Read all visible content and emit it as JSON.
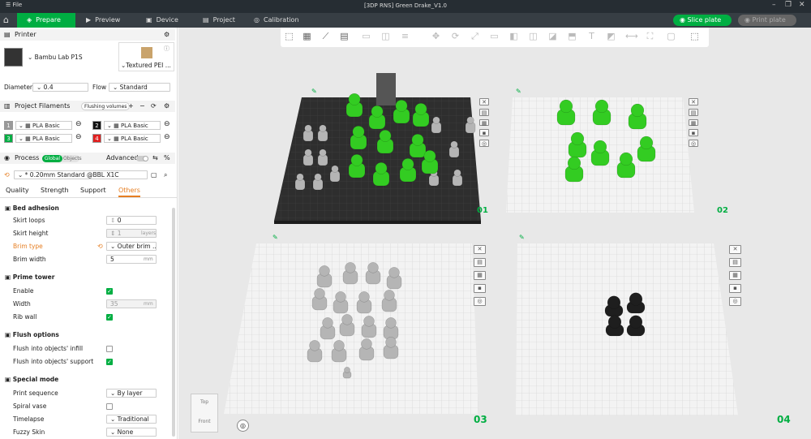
{
  "titlebar": {
    "file": "File",
    "title": "[3DP RNS] Green Drake_V1.0"
  },
  "nav": {
    "prepare": "Prepare",
    "preview": "Preview",
    "device": "Device",
    "project": "Project",
    "calibration": "Calibration",
    "slice": "Slice plate",
    "print": "Print plate"
  },
  "printer": {
    "section": "Printer",
    "name": "Bambu Lab P1S",
    "plate": "Textured PEI ...",
    "diameter_label": "Diameter",
    "diameter": "0.4",
    "flow_label": "Flow",
    "flow": "Standard"
  },
  "filaments": {
    "section": "Project Filaments",
    "flushing": "Flushing volumes",
    "items": [
      {
        "num": "1",
        "name": "PLA Basic",
        "color": "#9a9a9a"
      },
      {
        "num": "2",
        "name": "PLA Basic",
        "color": "#111111"
      },
      {
        "num": "3",
        "name": "PLA Basic",
        "color": "#00ae42"
      },
      {
        "num": "4",
        "name": "PLA Basic",
        "color": "#e02020"
      }
    ]
  },
  "process": {
    "section": "Process",
    "global": "Global",
    "objects": "Objects",
    "advanced": "Advanced",
    "preset": "* 0.20mm Standard @BBL X1C",
    "tabs": [
      "Quality",
      "Strength",
      "Support",
      "Others"
    ]
  },
  "bed": {
    "title": "Bed adhesion",
    "skirt_loops_label": "Skirt loops",
    "skirt_loops": "0",
    "skirt_height_label": "Skirt height",
    "skirt_height": "1",
    "skirt_height_unit": "layers",
    "brim_type_label": "Brim type",
    "brim_type": "Outer brim ...",
    "brim_width_label": "Brim width",
    "brim_width": "5",
    "brim_width_unit": "mm"
  },
  "prime": {
    "title": "Prime tower",
    "enable_label": "Enable",
    "width_label": "Width",
    "width": "35",
    "width_unit": "mm",
    "rib_label": "Rib wall"
  },
  "flush": {
    "title": "Flush options",
    "infill_label": "Flush into objects' infill",
    "support_label": "Flush into objects' support"
  },
  "special": {
    "title": "Special mode",
    "seq_label": "Print sequence",
    "seq": "By layer",
    "spiral_label": "Spiral vase",
    "timelapse_label": "Timelapse",
    "timelapse": "Traditional",
    "fuzzy_label": "Fuzzy Skin",
    "fuzzy": "None"
  },
  "viewport": {
    "plates": [
      "01",
      "02",
      "03",
      "04"
    ],
    "cube_top": "Top",
    "cube_front": "Front"
  }
}
